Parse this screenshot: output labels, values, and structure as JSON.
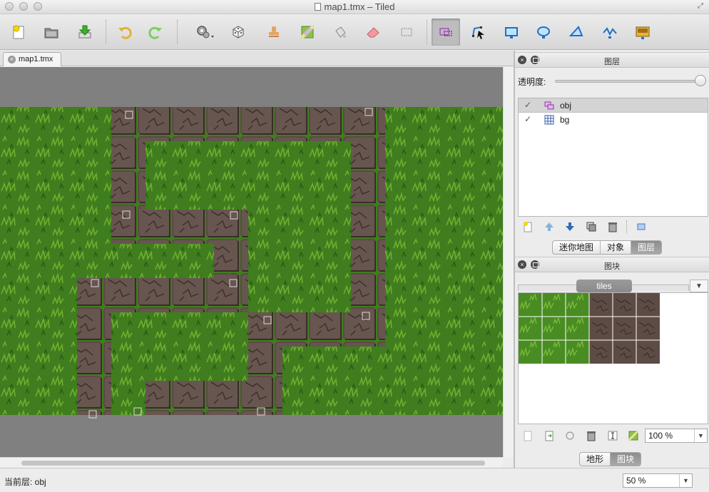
{
  "window": {
    "title": "map1.tmx – Tiled"
  },
  "toolbar": {
    "buttons": [
      {
        "name": "new-map",
        "icon": "new-document-icon"
      },
      {
        "name": "open",
        "icon": "folder-icon"
      },
      {
        "name": "save",
        "icon": "save-download-icon"
      },
      {
        "name": "undo",
        "icon": "undo-arrow-icon"
      },
      {
        "name": "redo",
        "icon": "redo-arrow-icon"
      },
      {
        "name": "commands",
        "icon": "gears-icon"
      },
      {
        "name": "random-mode",
        "icon": "dice-icon"
      },
      {
        "name": "stamp-brush",
        "icon": "stamp-icon"
      },
      {
        "name": "terrain-brush",
        "icon": "terrain-brush-icon"
      },
      {
        "name": "bucket-fill",
        "icon": "bucket-fill-icon"
      },
      {
        "name": "eraser",
        "icon": "eraser-icon"
      },
      {
        "name": "rect-select",
        "icon": "rectangle-select-icon"
      },
      {
        "name": "select-objects",
        "icon": "select-objects-icon",
        "active": true
      },
      {
        "name": "edit-polygons",
        "icon": "edit-polygons-icon"
      },
      {
        "name": "insert-rectangle",
        "icon": "insert-rectangle-icon"
      },
      {
        "name": "insert-ellipse",
        "icon": "insert-ellipse-icon"
      },
      {
        "name": "insert-polygon",
        "icon": "insert-polygon-icon"
      },
      {
        "name": "insert-polyline",
        "icon": "insert-polyline-icon"
      },
      {
        "name": "insert-tile",
        "icon": "insert-tile-icon"
      }
    ]
  },
  "document_tab": {
    "label": "map1.tmx"
  },
  "map": {
    "tile_size_px": 48,
    "grass_color": "#3f7d1f",
    "stone_color": "#5b4a44",
    "background_color": "#808080",
    "stone_tiles": [
      [
        3,
        0
      ],
      [
        4,
        0
      ],
      [
        5,
        0
      ],
      [
        6,
        0
      ],
      [
        7,
        0
      ],
      [
        8,
        0
      ],
      [
        9,
        0
      ],
      [
        10,
        0
      ],
      [
        3,
        1
      ],
      [
        10,
        1
      ],
      [
        3,
        2
      ],
      [
        10,
        2
      ],
      [
        3,
        3
      ],
      [
        4,
        3
      ],
      [
        5,
        3
      ],
      [
        6,
        3
      ],
      [
        10,
        3
      ],
      [
        6,
        4
      ],
      [
        10,
        4
      ],
      [
        2,
        5
      ],
      [
        3,
        5
      ],
      [
        4,
        5
      ],
      [
        5,
        5
      ],
      [
        6,
        5
      ],
      [
        10,
        5
      ],
      [
        2,
        6
      ],
      [
        7,
        6
      ],
      [
        8,
        6
      ],
      [
        9,
        6
      ],
      [
        10,
        6
      ],
      [
        2,
        7
      ],
      [
        7,
        7
      ],
      [
        2,
        8
      ],
      [
        4,
        8
      ],
      [
        5,
        8
      ],
      [
        6,
        8
      ],
      [
        7,
        8
      ]
    ]
  },
  "layers_panel": {
    "title": "图层",
    "opacity_label": "透明度:",
    "opacity_value": 1.0,
    "layers": [
      {
        "name": "obj",
        "type": "object-layer",
        "visible": true,
        "selected": true
      },
      {
        "name": "bg",
        "type": "tile-layer",
        "visible": true,
        "selected": false
      }
    ],
    "tabs": [
      {
        "label": "迷你地图",
        "active": false
      },
      {
        "label": "对象",
        "active": false
      },
      {
        "label": "图层",
        "active": true
      }
    ]
  },
  "tilesets_panel": {
    "title": "图块",
    "tileset_name": "tiles",
    "zoom": "100 %",
    "tabs": [
      {
        "label": "地形",
        "active": false
      },
      {
        "label": "图块",
        "active": true
      }
    ]
  },
  "status": {
    "current_layer": "当前层: obj",
    "zoom": "50 %"
  }
}
